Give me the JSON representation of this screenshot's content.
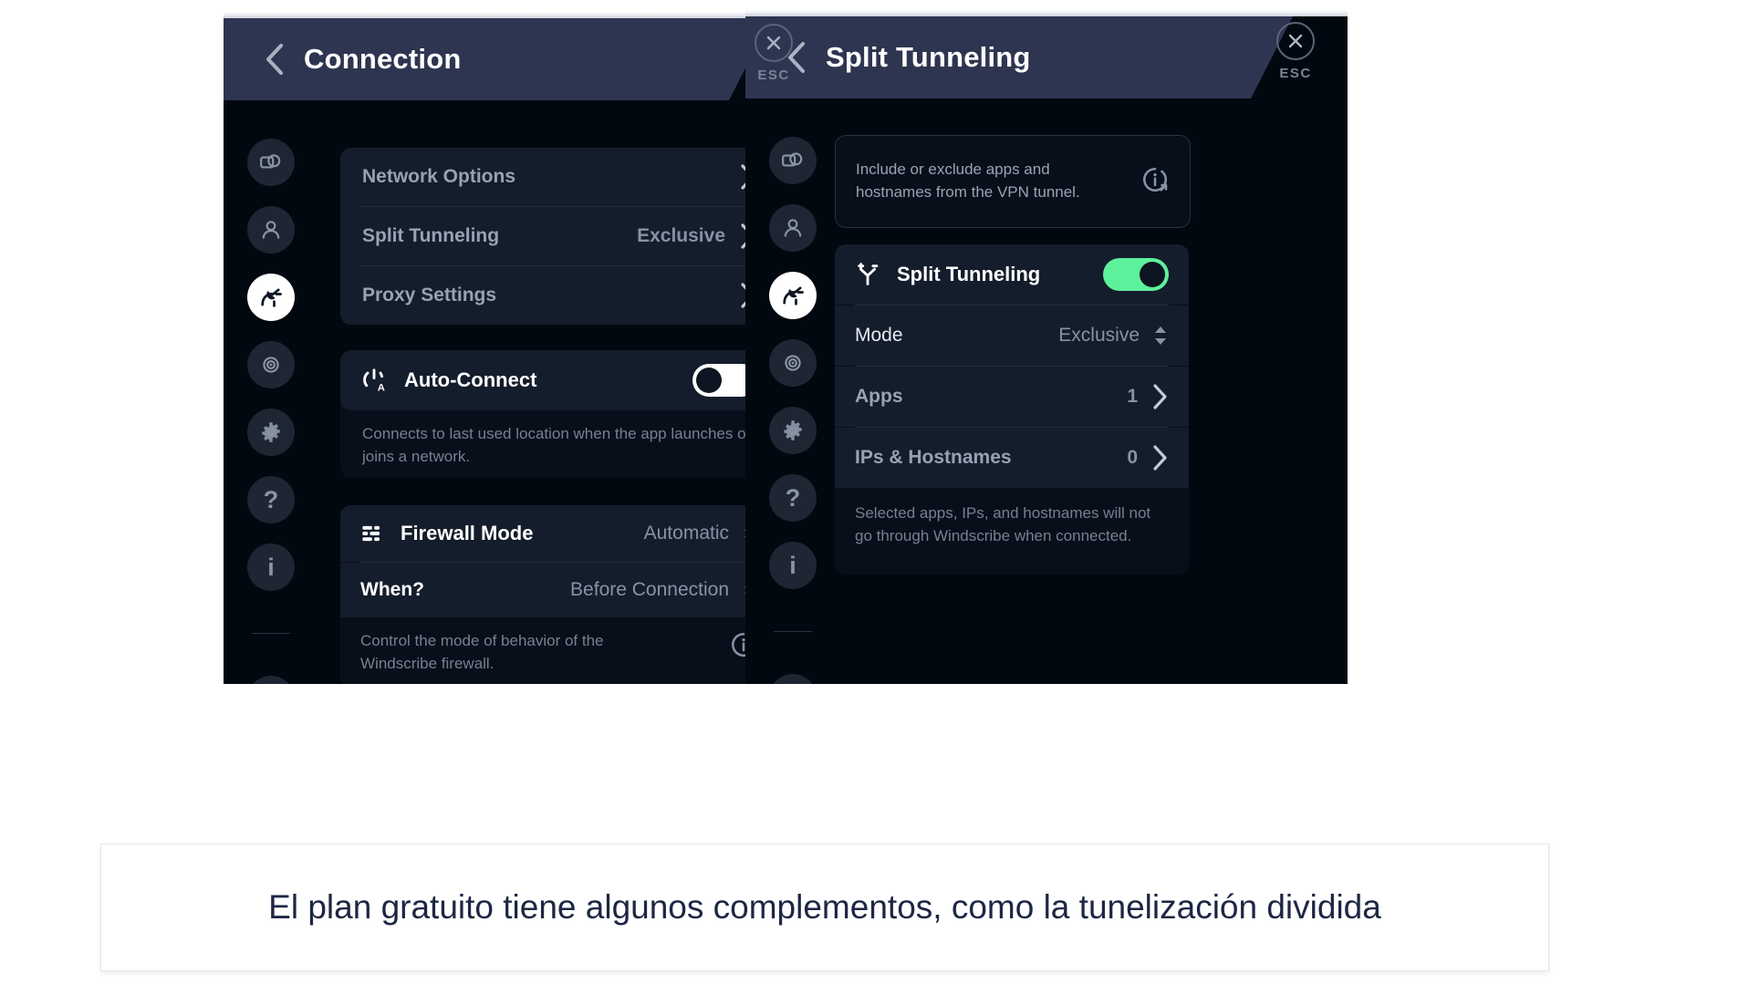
{
  "caption": {
    "text": "El plan gratuito tiene algunos complementos, como la tunelización dividida"
  },
  "left_window": {
    "header": {
      "title": "Connection",
      "back_icon": "chevron-left-icon",
      "close_icon": "close-icon",
      "esc_label": "ESC"
    },
    "sidebar": {
      "items": [
        {
          "name": "sidebar-item-general",
          "icon": "screen-general-icon",
          "active": false
        },
        {
          "name": "sidebar-item-account",
          "icon": "person-account-icon",
          "active": false
        },
        {
          "name": "sidebar-item-connection",
          "icon": "plug-connection-icon",
          "active": true
        },
        {
          "name": "sidebar-item-robert",
          "icon": "robert-eye-icon",
          "active": false
        },
        {
          "name": "sidebar-item-preferences",
          "icon": "gear-icon",
          "active": false
        },
        {
          "name": "sidebar-item-help",
          "icon": "question-mark-icon",
          "active": false
        },
        {
          "name": "sidebar-item-about",
          "icon": "info-icon",
          "active": false
        },
        {
          "name": "sidebar-item-logout",
          "icon": "exit-door-icon",
          "active": false
        }
      ]
    },
    "menu_card": {
      "rows": [
        {
          "label": "Network Options",
          "value": "",
          "affordance": "chevron-right-icon"
        },
        {
          "label": "Split Tunneling",
          "value": "Exclusive",
          "affordance": "chevron-right-icon"
        },
        {
          "label": "Proxy Settings",
          "value": "",
          "affordance": "chevron-right-icon"
        }
      ]
    },
    "auto_connect": {
      "icon": "auto-connect-power-icon",
      "label": "Auto-Connect",
      "toggle_state": "off",
      "description": "Connects to last used location when the app launches or joins a network."
    },
    "firewall": {
      "icon": "firewall-bars-icon",
      "label": "Firewall Mode",
      "value": "Automatic",
      "when_label": "When?",
      "when_value": "Before Connection",
      "description": "Control the mode of behavior of the Windscribe firewall.",
      "info_icon": "info-external-link-icon"
    }
  },
  "right_window": {
    "header": {
      "title": "Split Tunneling",
      "back_icon": "chevron-left-icon",
      "close_icon": "close-icon",
      "esc_label": "ESC"
    },
    "sidebar": {
      "items": [
        {
          "name": "sidebar-item-general",
          "icon": "screen-general-icon",
          "active": false
        },
        {
          "name": "sidebar-item-account",
          "icon": "person-account-icon",
          "active": false
        },
        {
          "name": "sidebar-item-connection",
          "icon": "plug-connection-icon",
          "active": true
        },
        {
          "name": "sidebar-item-robert",
          "icon": "robert-eye-icon",
          "active": false
        },
        {
          "name": "sidebar-item-preferences",
          "icon": "gear-icon",
          "active": false
        },
        {
          "name": "sidebar-item-help",
          "icon": "question-mark-icon",
          "active": false
        },
        {
          "name": "sidebar-item-about",
          "icon": "info-icon",
          "active": false
        },
        {
          "name": "sidebar-item-logout",
          "icon": "exit-door-icon",
          "active": false
        }
      ]
    },
    "info_banner": {
      "text": "Include or exclude apps and hostnames from the VPN tunnel.",
      "icon": "info-external-link-icon"
    },
    "split_tunneling": {
      "icon": "split-tunneling-fork-icon",
      "label": "Split Tunneling",
      "toggle_state": "on",
      "mode_label": "Mode",
      "mode_value": "Exclusive",
      "apps_label": "Apps",
      "apps_count": "1",
      "ips_label": "IPs & Hostnames",
      "ips_count": "0",
      "description": "Selected apps, IPs, and hostnames will not go through Windscribe when connected."
    }
  },
  "colors": {
    "accent_green": "#5ef19c",
    "header_bar": "#2e3550",
    "card_bg": "#141d2b",
    "app_bg": "#02080f",
    "muted_text": "#8892a4"
  }
}
